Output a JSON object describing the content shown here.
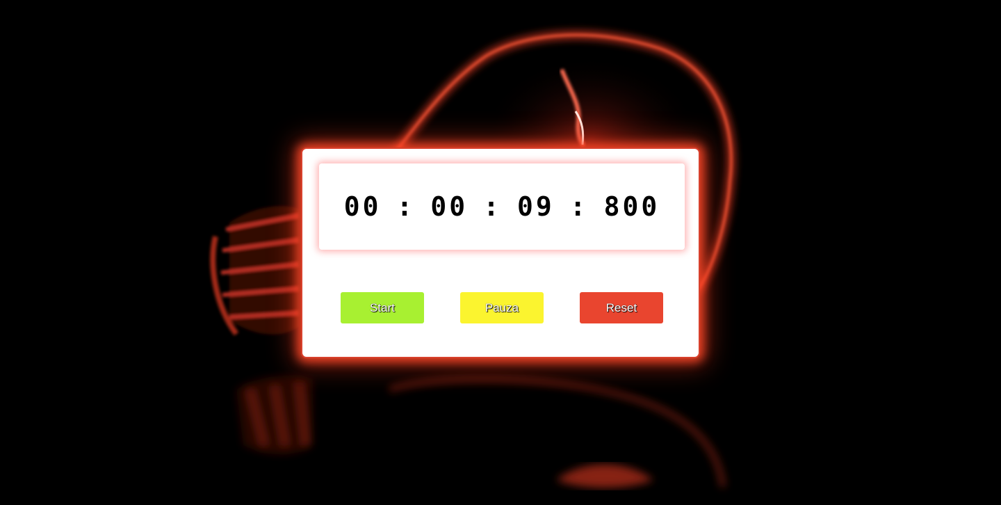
{
  "timer": {
    "hours": "00",
    "minutes": "00",
    "seconds": "09",
    "milliseconds": "800",
    "separator": ":"
  },
  "buttons": {
    "start": {
      "label": "Start",
      "color": "#a8f031"
    },
    "pause": {
      "label": "Pauza",
      "color": "#fbf42f"
    },
    "reset": {
      "label": "Reset",
      "color": "#e9452f"
    }
  },
  "colors": {
    "background": "#000000",
    "card": "#ffffff",
    "glow": "#ff4828",
    "bulb": "#e03a22"
  }
}
